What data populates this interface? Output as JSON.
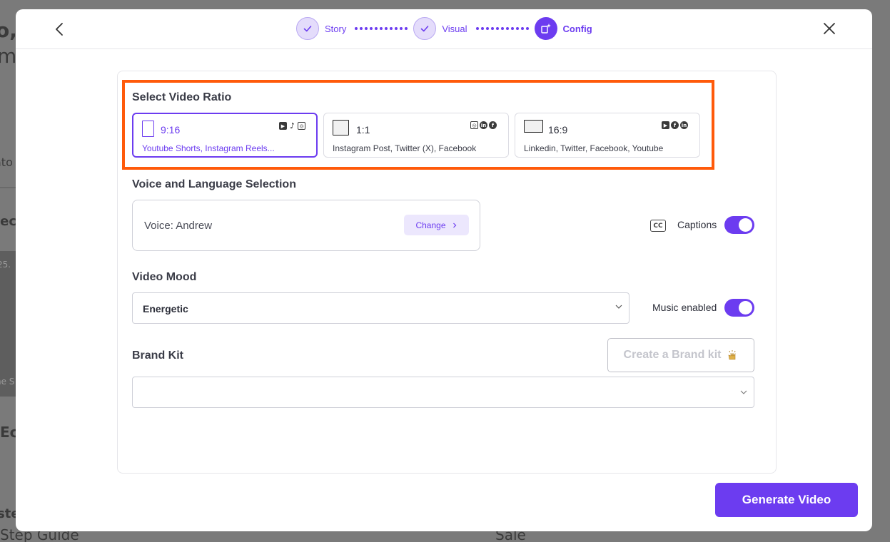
{
  "background": {
    "fragments": [
      "o, a",
      "m",
      "ato",
      "lec",
      "25.",
      "ne S",
      "Ec",
      "ste",
      "Step Guide",
      "Sale"
    ]
  },
  "stepper": {
    "steps": [
      {
        "label": "Story",
        "state": "done"
      },
      {
        "label": "Visual",
        "state": "done"
      },
      {
        "label": "Config",
        "state": "active"
      }
    ]
  },
  "ratio": {
    "title": "Select Video Ratio",
    "options": [
      {
        "value": "9:16",
        "desc": "Youtube Shorts, Instagram Reels...",
        "selected": true,
        "socials": [
          "youtube-icon",
          "tiktok-icon",
          "instagram-icon"
        ]
      },
      {
        "value": "1:1",
        "desc": "Instagram Post, Twitter (X), Facebook",
        "selected": false,
        "socials": [
          "instagram-icon",
          "linkedin-icon",
          "facebook-icon"
        ]
      },
      {
        "value": "16:9",
        "desc": "Linkedin, Twitter, Facebook, Youtube",
        "selected": false,
        "socials": [
          "youtube-icon",
          "facebook-icon",
          "linkedin-icon"
        ]
      }
    ]
  },
  "voice": {
    "title": "Voice and Language Selection",
    "current": "Voice: Andrew",
    "change_label": "Change",
    "captions_label": "Captions",
    "captions_on": true
  },
  "mood": {
    "title": "Video Mood",
    "selected": "Energetic",
    "music_label": "Music enabled",
    "music_on": true
  },
  "brand": {
    "title": "Brand Kit",
    "create_label": "Create a Brand kit",
    "selected": ""
  },
  "actions": {
    "generate_label": "Generate Video"
  },
  "colors": {
    "accent": "#6c3cf0",
    "highlight": "#ff5a0a"
  }
}
